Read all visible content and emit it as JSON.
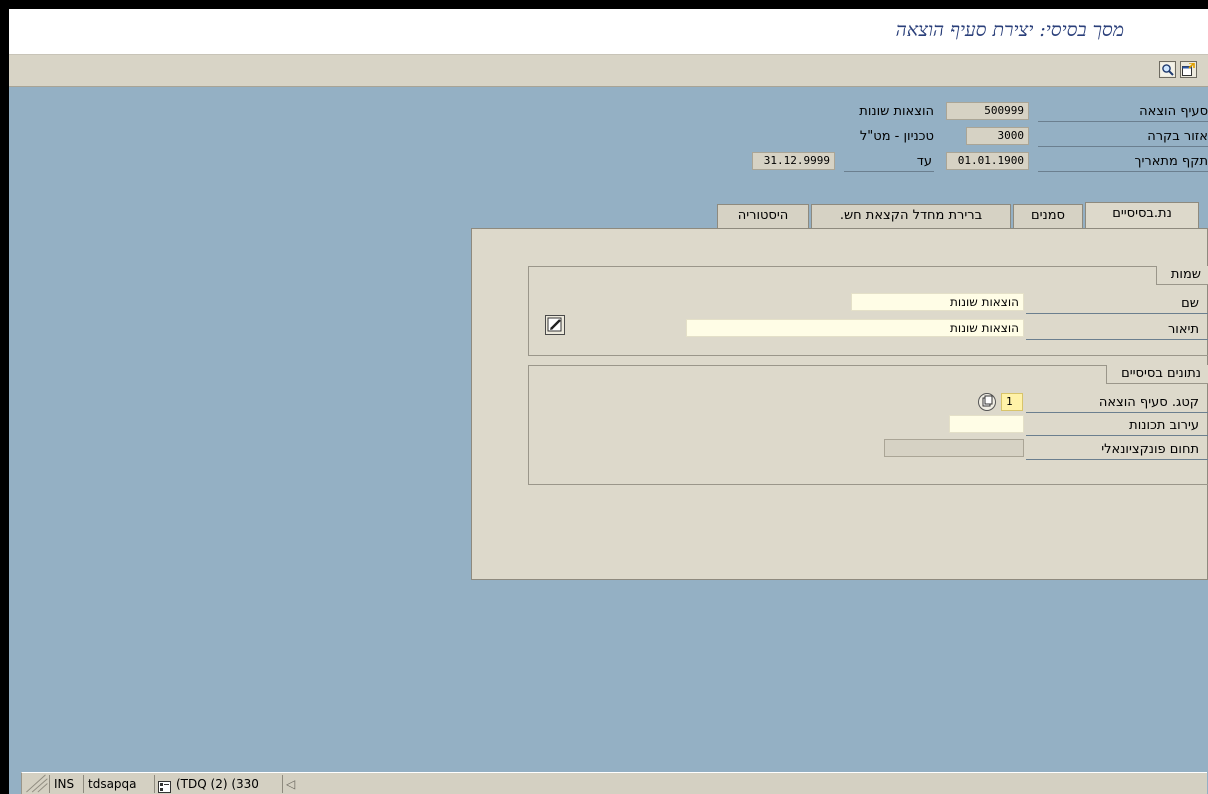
{
  "window": {
    "title": "מסך בסיסי: יצירת סעיף הוצאה"
  },
  "toolbar": {
    "icons": [
      "find-icon",
      "new-window-icon"
    ]
  },
  "header": {
    "cost_element": {
      "label": "סעיף הוצאה",
      "value": "500999",
      "description": "הוצאות שונות"
    },
    "controlling_area": {
      "label": "אזור בקרה",
      "value": "3000",
      "description": "טכניון - מט\"ל"
    },
    "valid_from": {
      "label": "תקף מתאריך",
      "value": "01.01.1900"
    },
    "valid_to": {
      "label": "עד",
      "value": "31.12.9999"
    }
  },
  "tabs": [
    {
      "label": "נת.בסיסיים",
      "active": true
    },
    {
      "label": "סמנים",
      "active": false
    },
    {
      "label": "ברירת מחדל הקצאת חש.",
      "active": false
    },
    {
      "label": "היסטוריה",
      "active": false
    }
  ],
  "names_group": {
    "title": "שמות",
    "name": {
      "label": "שם",
      "value": "הוצאות שונות"
    },
    "description": {
      "label": "תיאור",
      "value": "הוצאות שונות"
    }
  },
  "basic_data_group": {
    "title": "נתונים בסיסיים",
    "category": {
      "label": "קטג. סעיף הוצאה",
      "value": "1"
    },
    "attribute_mix": {
      "label": "עירוב תכונות",
      "value": ""
    },
    "functional_area": {
      "label": "תחום פונקציונאלי",
      "value": ""
    }
  },
  "statusbar": {
    "mode": "INS",
    "server": "tdsapqa",
    "system": "(TDQ (2) (330"
  },
  "colors": {
    "background": "#94b0c4",
    "panel": "#ddd9cb",
    "title": "#2a3f7a",
    "input_bg": "#fffde6"
  }
}
